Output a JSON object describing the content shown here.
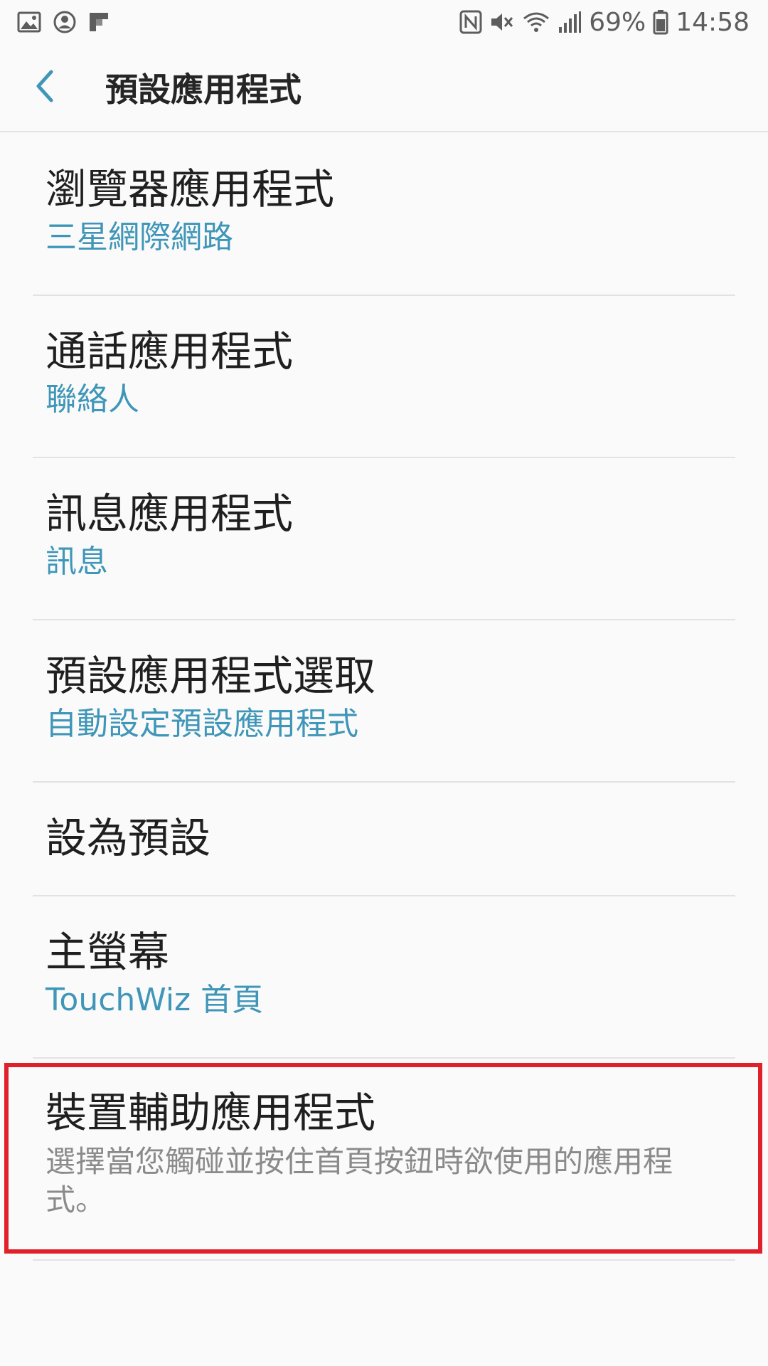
{
  "status_bar": {
    "battery_percent": "69%",
    "time": "14:58",
    "icons_left": [
      "gallery-icon",
      "account-circle-icon",
      "flipboard-icon"
    ],
    "icons_right": [
      "nfc-icon",
      "mute-icon",
      "wifi-icon",
      "signal-icon",
      "battery-icon"
    ]
  },
  "app_bar": {
    "title": "預設應用程式",
    "back_icon": "chevron-left-icon"
  },
  "items": [
    {
      "title": "瀏覽器應用程式",
      "subtitle": "三星網際網路"
    },
    {
      "title": "通話應用程式",
      "subtitle": "聯絡人"
    },
    {
      "title": "訊息應用程式",
      "subtitle": "訊息"
    },
    {
      "title": "預設應用程式選取",
      "subtitle": "自動設定預設應用程式"
    },
    {
      "title": "設為預設"
    },
    {
      "title": "主螢幕",
      "subtitle": "TouchWiz 首頁"
    },
    {
      "title": "裝置輔助應用程式",
      "description": "選擇當您觸碰並按住首頁按鈕時欲使用的應用程式。"
    }
  ],
  "colors": {
    "background": "#fafafa",
    "accent": "#3f96b8",
    "title_text": "#1f1f1f",
    "secondary_text": "#8a8a8a",
    "highlight": "#e0202a"
  }
}
